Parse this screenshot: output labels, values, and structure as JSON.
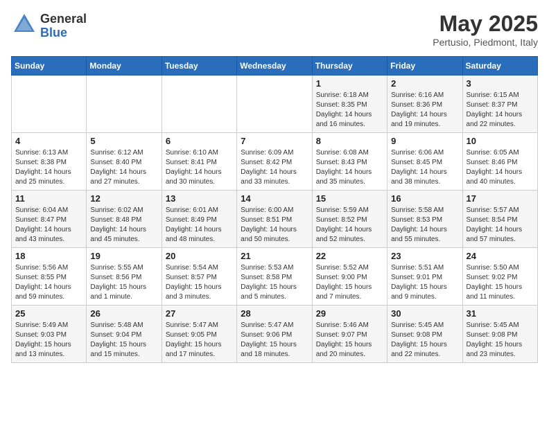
{
  "header": {
    "logo_general": "General",
    "logo_blue": "Blue",
    "month_title": "May 2025",
    "location": "Pertusio, Piedmont, Italy"
  },
  "weekdays": [
    "Sunday",
    "Monday",
    "Tuesday",
    "Wednesday",
    "Thursday",
    "Friday",
    "Saturday"
  ],
  "weeks": [
    [
      {
        "day": "",
        "info": ""
      },
      {
        "day": "",
        "info": ""
      },
      {
        "day": "",
        "info": ""
      },
      {
        "day": "",
        "info": ""
      },
      {
        "day": "1",
        "info": "Sunrise: 6:18 AM\nSunset: 8:35 PM\nDaylight: 14 hours\nand 16 minutes."
      },
      {
        "day": "2",
        "info": "Sunrise: 6:16 AM\nSunset: 8:36 PM\nDaylight: 14 hours\nand 19 minutes."
      },
      {
        "day": "3",
        "info": "Sunrise: 6:15 AM\nSunset: 8:37 PM\nDaylight: 14 hours\nand 22 minutes."
      }
    ],
    [
      {
        "day": "4",
        "info": "Sunrise: 6:13 AM\nSunset: 8:38 PM\nDaylight: 14 hours\nand 25 minutes."
      },
      {
        "day": "5",
        "info": "Sunrise: 6:12 AM\nSunset: 8:40 PM\nDaylight: 14 hours\nand 27 minutes."
      },
      {
        "day": "6",
        "info": "Sunrise: 6:10 AM\nSunset: 8:41 PM\nDaylight: 14 hours\nand 30 minutes."
      },
      {
        "day": "7",
        "info": "Sunrise: 6:09 AM\nSunset: 8:42 PM\nDaylight: 14 hours\nand 33 minutes."
      },
      {
        "day": "8",
        "info": "Sunrise: 6:08 AM\nSunset: 8:43 PM\nDaylight: 14 hours\nand 35 minutes."
      },
      {
        "day": "9",
        "info": "Sunrise: 6:06 AM\nSunset: 8:45 PM\nDaylight: 14 hours\nand 38 minutes."
      },
      {
        "day": "10",
        "info": "Sunrise: 6:05 AM\nSunset: 8:46 PM\nDaylight: 14 hours\nand 40 minutes."
      }
    ],
    [
      {
        "day": "11",
        "info": "Sunrise: 6:04 AM\nSunset: 8:47 PM\nDaylight: 14 hours\nand 43 minutes."
      },
      {
        "day": "12",
        "info": "Sunrise: 6:02 AM\nSunset: 8:48 PM\nDaylight: 14 hours\nand 45 minutes."
      },
      {
        "day": "13",
        "info": "Sunrise: 6:01 AM\nSunset: 8:49 PM\nDaylight: 14 hours\nand 48 minutes."
      },
      {
        "day": "14",
        "info": "Sunrise: 6:00 AM\nSunset: 8:51 PM\nDaylight: 14 hours\nand 50 minutes."
      },
      {
        "day": "15",
        "info": "Sunrise: 5:59 AM\nSunset: 8:52 PM\nDaylight: 14 hours\nand 52 minutes."
      },
      {
        "day": "16",
        "info": "Sunrise: 5:58 AM\nSunset: 8:53 PM\nDaylight: 14 hours\nand 55 minutes."
      },
      {
        "day": "17",
        "info": "Sunrise: 5:57 AM\nSunset: 8:54 PM\nDaylight: 14 hours\nand 57 minutes."
      }
    ],
    [
      {
        "day": "18",
        "info": "Sunrise: 5:56 AM\nSunset: 8:55 PM\nDaylight: 14 hours\nand 59 minutes."
      },
      {
        "day": "19",
        "info": "Sunrise: 5:55 AM\nSunset: 8:56 PM\nDaylight: 15 hours\nand 1 minute."
      },
      {
        "day": "20",
        "info": "Sunrise: 5:54 AM\nSunset: 8:57 PM\nDaylight: 15 hours\nand 3 minutes."
      },
      {
        "day": "21",
        "info": "Sunrise: 5:53 AM\nSunset: 8:58 PM\nDaylight: 15 hours\nand 5 minutes."
      },
      {
        "day": "22",
        "info": "Sunrise: 5:52 AM\nSunset: 9:00 PM\nDaylight: 15 hours\nand 7 minutes."
      },
      {
        "day": "23",
        "info": "Sunrise: 5:51 AM\nSunset: 9:01 PM\nDaylight: 15 hours\nand 9 minutes."
      },
      {
        "day": "24",
        "info": "Sunrise: 5:50 AM\nSunset: 9:02 PM\nDaylight: 15 hours\nand 11 minutes."
      }
    ],
    [
      {
        "day": "25",
        "info": "Sunrise: 5:49 AM\nSunset: 9:03 PM\nDaylight: 15 hours\nand 13 minutes."
      },
      {
        "day": "26",
        "info": "Sunrise: 5:48 AM\nSunset: 9:04 PM\nDaylight: 15 hours\nand 15 minutes."
      },
      {
        "day": "27",
        "info": "Sunrise: 5:47 AM\nSunset: 9:05 PM\nDaylight: 15 hours\nand 17 minutes."
      },
      {
        "day": "28",
        "info": "Sunrise: 5:47 AM\nSunset: 9:06 PM\nDaylight: 15 hours\nand 18 minutes."
      },
      {
        "day": "29",
        "info": "Sunrise: 5:46 AM\nSunset: 9:07 PM\nDaylight: 15 hours\nand 20 minutes."
      },
      {
        "day": "30",
        "info": "Sunrise: 5:45 AM\nSunset: 9:08 PM\nDaylight: 15 hours\nand 22 minutes."
      },
      {
        "day": "31",
        "info": "Sunrise: 5:45 AM\nSunset: 9:08 PM\nDaylight: 15 hours\nand 23 minutes."
      }
    ]
  ]
}
